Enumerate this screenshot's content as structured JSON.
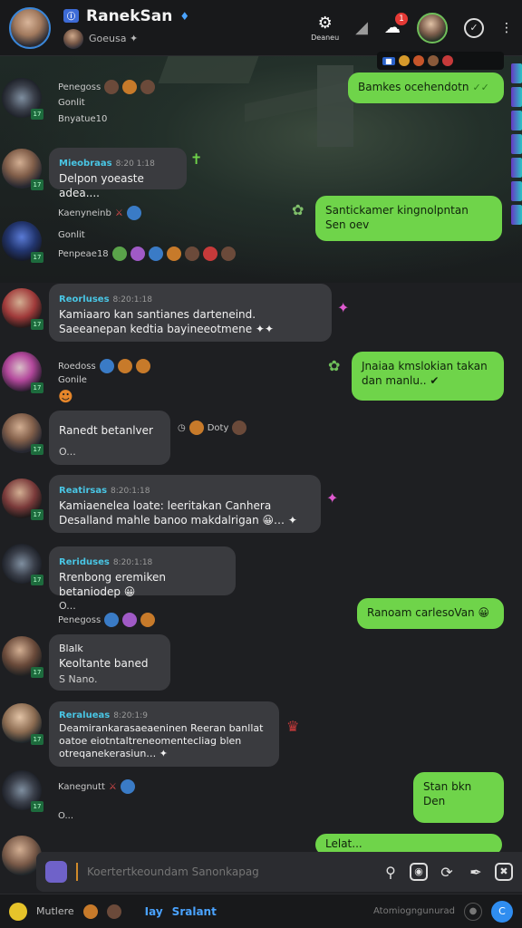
{
  "header": {
    "tag": "ⓘ",
    "title": "RanekSan",
    "subtitle": "Goeusa ✦",
    "btn1_label": "Deaneu",
    "notif_count": "1"
  },
  "messages": [
    {
      "meta": "Penegoss",
      "lines": [
        "Gonlit",
        "Bnyatue10"
      ]
    },
    {
      "name": "Mieobraas",
      "time": "8:20 1:18",
      "text": "Delpon yoeaste adea...."
    },
    {
      "meta": "Kaenyneinb",
      "lines": [
        "Gonlit",
        "Penpeae18"
      ]
    },
    {
      "name": "Reorluses",
      "time": "8:20:1:18",
      "text": "Kamiaaro kan santianes darteneind. Saeeanepan kedtia bayineeotmene ✦✦"
    },
    {
      "meta": "Roedoss",
      "lines": [
        "Gonile"
      ]
    },
    {
      "name": "",
      "time": "",
      "text": "Ranedt betanlver",
      "sub": "O...",
      "side": "Doty"
    },
    {
      "name": "Reatirsas",
      "time": "8:20:1:18",
      "text": "Kamiaenelea loate: leeritakan Canhera Desalland mahle banoo makdalrigan 😀… ✦"
    },
    {
      "name": "Reriduses",
      "time": "8:20:1:18",
      "text": "Rrenbong eremiken betaniodep 😀",
      "sub": "O..."
    },
    {
      "meta": "Penegoss"
    },
    {
      "name": "Blalk",
      "time": "",
      "text": "Keoltante baned",
      "sub": "S Nano."
    },
    {
      "name": "Reralueas",
      "time": "8:20:1:9",
      "text": "Deamirankarasaeaeninen Reeran banllat oatoe eiotntaltreneomentecliag blen otreqanekerasiun… ✦"
    },
    {
      "meta": "Kanegnutt",
      "lines": [
        "O..."
      ]
    }
  ],
  "outgoing": [
    {
      "text": "Bamkes ocehendotn"
    },
    {
      "text": "Santickamer kingnolpntan Sen oev"
    },
    {
      "text": "Jnaiaa kmslokian takan dan manlu.. ✔"
    },
    {
      "text": "Ranoam carlesoVan 😀"
    },
    {
      "text": "Stan bkn Den"
    },
    {
      "text": "Lelat..."
    }
  ],
  "composer": {
    "placeholder": "Koertertkeoundam Sanonkapag"
  },
  "bottom": {
    "label1": "Mutlere",
    "tab1": "Iay",
    "tab2": "Sralant",
    "hint": "Atomiogngunurad"
  }
}
